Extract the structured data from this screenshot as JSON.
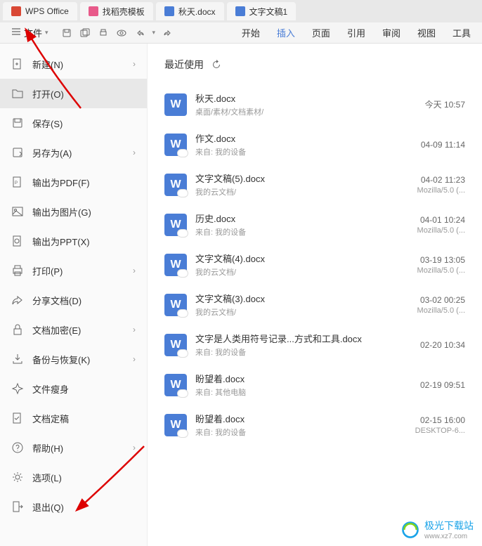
{
  "tabs": [
    {
      "label": "WPS Office",
      "iconClass": "wps-red"
    },
    {
      "label": "找稻壳模板",
      "iconClass": "search-pink"
    },
    {
      "label": "秋天.docx",
      "iconClass": "word-blue"
    },
    {
      "label": "文字文稿1",
      "iconClass": "word-blue"
    }
  ],
  "fileButton": "文件",
  "ribbonTabs": [
    "开始",
    "插入",
    "页面",
    "引用",
    "审阅",
    "视图",
    "工具"
  ],
  "activeRibbon": 1,
  "sidebar": [
    {
      "label": "新建(N)",
      "icon": "plus-page",
      "chevron": true
    },
    {
      "label": "打开(O)",
      "icon": "folder",
      "chevron": false,
      "highlight": true
    },
    {
      "label": "保存(S)",
      "icon": "save",
      "chevron": false
    },
    {
      "label": "另存为(A)",
      "icon": "save-as",
      "chevron": true
    },
    {
      "label": "输出为PDF(F)",
      "icon": "pdf",
      "chevron": false
    },
    {
      "label": "输出为图片(G)",
      "icon": "image",
      "chevron": false
    },
    {
      "label": "输出为PPT(X)",
      "icon": "ppt",
      "chevron": false
    },
    {
      "label": "打印(P)",
      "icon": "print",
      "chevron": true
    },
    {
      "label": "分享文档(D)",
      "icon": "share",
      "chevron": false
    },
    {
      "label": "文档加密(E)",
      "icon": "lock",
      "chevron": true
    },
    {
      "label": "备份与恢复(K)",
      "icon": "backup",
      "chevron": true
    },
    {
      "label": "文件瘦身",
      "icon": "sparkle",
      "chevron": false
    },
    {
      "label": "文档定稿",
      "icon": "check",
      "chevron": false
    },
    {
      "label": "帮助(H)",
      "icon": "help",
      "chevron": true
    },
    {
      "label": "选项(L)",
      "icon": "settings",
      "chevron": false
    },
    {
      "label": "退出(Q)",
      "icon": "exit",
      "chevron": false
    }
  ],
  "panelTitle": "最近使用",
  "files": [
    {
      "name": "秋天.docx",
      "meta": "桌面/素材/文档素材/",
      "date": "今天 10:57",
      "extra": "",
      "cloud": false
    },
    {
      "name": "作文.docx",
      "meta": "来自: 我的设备",
      "date": "04-09 11:14",
      "extra": "",
      "cloud": true
    },
    {
      "name": "文字文稿(5).docx",
      "meta": "我的云文档/",
      "date": "04-02 11:23",
      "extra": "Mozilla/5.0 (...",
      "cloud": true
    },
    {
      "name": "历史.docx",
      "meta": "来自: 我的设备",
      "date": "04-01 10:24",
      "extra": "Mozilla/5.0 (...",
      "cloud": true
    },
    {
      "name": "文字文稿(4).docx",
      "meta": "我的云文档/",
      "date": "03-19 13:05",
      "extra": "Mozilla/5.0 (...",
      "cloud": true
    },
    {
      "name": "文字文稿(3).docx",
      "meta": "我的云文档/",
      "date": "03-02 00:25",
      "extra": "Mozilla/5.0 (...",
      "cloud": true
    },
    {
      "name": "文字是人类用符号记录...方式和工具.docx",
      "meta": "来自: 我的设备",
      "date": "02-20 10:34",
      "extra": "",
      "cloud": true
    },
    {
      "name": "盼望着.docx",
      "meta": "来自: 其他电脑",
      "date": "02-19 09:51",
      "extra": "",
      "cloud": true
    },
    {
      "name": "盼望着.docx",
      "meta": "来自: 我的设备",
      "date": "02-15 16:00",
      "extra": "DESKTOP-6...",
      "cloud": true
    }
  ],
  "watermark": {
    "name": "极光下载站",
    "url": "www.xz7.com"
  }
}
